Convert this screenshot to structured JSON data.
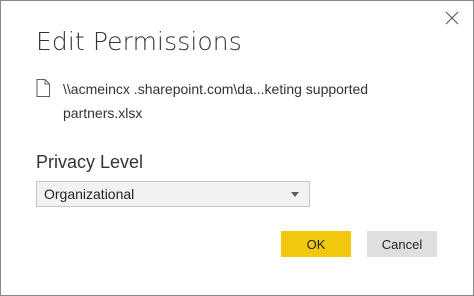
{
  "dialog": {
    "title": "Edit Permissions",
    "file_path": "\\\\acmeincx .sharepoint.com\\da...keting supported partners.xlsx",
    "privacy_level_label": "Privacy Level",
    "privacy_level_value": "Organizational",
    "ok_label": "OK",
    "cancel_label": "Cancel"
  },
  "icons": {
    "close": "close-icon",
    "file": "file-icon",
    "dropdown": "chevron-down-icon"
  },
  "colors": {
    "ok_button": "#f2c80f",
    "cancel_button": "#e1dfdd",
    "select_background": "#f3f2f1"
  }
}
